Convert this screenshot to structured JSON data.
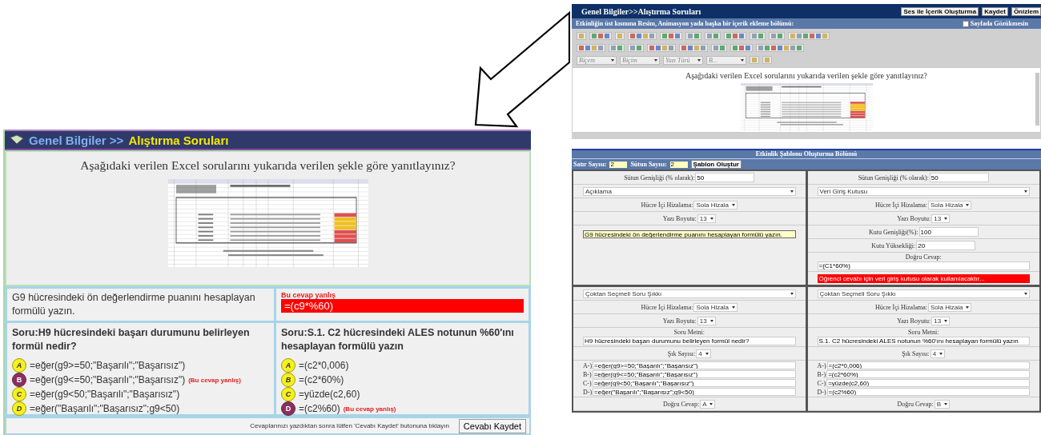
{
  "student_view": {
    "header": {
      "path": "Genel Bilgiler >>",
      "title": "Alıştırma Soruları"
    },
    "instruction": "Aşağıdaki verilen Excel sorularını yukarıda verilen şekle göre yanıtlayınız?",
    "open_question": {
      "text": "G9 hücresindeki ön değerlendirme puanını hesaplayan formülü yazın.",
      "error": "Bu cevap yanlış",
      "answer": "=(c9*%60)"
    },
    "choice_questions": [
      {
        "question": "Soru:H9 hücresindeki başarı durumunu belirleyen formül nedir?",
        "options": [
          {
            "letter": "A",
            "text": "=eğer(g9>=50;\"Başarılı\";\"Başarısız\")",
            "selected": false
          },
          {
            "letter": "B",
            "text": "=eğer(g9<=50;\"Başarılı\";\"Başarısız\")",
            "selected": true,
            "note": "(Bu cevap yanlış)"
          },
          {
            "letter": "C",
            "text": "=eğer(g9<50;\"Başarılı\";\"Başarısız\")",
            "selected": false
          },
          {
            "letter": "D",
            "text": "=eğer(\"Başarılı\";\"Başarısız\";g9<50)",
            "selected": false
          }
        ]
      },
      {
        "question": "Soru:S.1. C2 hücresindeki ALES notunun %60'ını hesaplayan formülü yazın",
        "options": [
          {
            "letter": "A",
            "text": "=(c2*0,006)",
            "selected": false
          },
          {
            "letter": "B",
            "text": "=(c2*60%)",
            "selected": false
          },
          {
            "letter": "C",
            "text": "=yüzde(c2,60)",
            "selected": false
          },
          {
            "letter": "D",
            "text": "=(c2%60)",
            "selected": true,
            "note": "(Bu cevap yanlış)"
          }
        ]
      }
    ],
    "footer": {
      "note": "Cevaplarınızı yazdıktan sonra lütfen 'Cevabı Kaydet' butonuna tıklayın",
      "button": "Cevabı Kaydet"
    }
  },
  "editor_view": {
    "title": "Genel Bilgiler>>Alıştırma Soruları",
    "buttons": [
      "Ses ile İçerik Oluşturma",
      "Kaydet",
      "Önizlem"
    ],
    "content_bar": {
      "label": "Etkinliğin üst kısmına Resim, Animasyon yada başka bir içerik ekleme bölümü:",
      "hide_label": "Sayfada Gözükmesin",
      "checked": false
    },
    "combos": [
      "Biçem",
      "Biçim",
      "Yazı Türü",
      "B..."
    ],
    "instruction": "Aşağıdaki verilen Excel sorularını yukarıda verilen şekle göre yanıtlayınız?",
    "template": {
      "title": "Etkinlik Şablonu Oluşturma Bölümü",
      "row_label": "Satır Sayısı:",
      "rows": "2",
      "col_label": "Sütun Sayısı:",
      "cols": "2",
      "button": "Şablon Oluştur",
      "cells": [
        {
          "fields": [
            {
              "kind": "input",
              "label": "Sütun Genişliği (% olarak):",
              "value": "50"
            },
            {
              "kind": "wide_select",
              "value": "Açıklama"
            },
            {
              "kind": "select",
              "label": "Hücre İçi Hizalama:",
              "value": "Sola Hizala"
            },
            {
              "kind": "select",
              "label": "Yazı Boyutu:",
              "value": "13"
            },
            {
              "kind": "text",
              "value": "G9 hücresindeki ön değerlendirme puanını hesaplayan formülü yazın."
            }
          ]
        },
        {
          "fields": [
            {
              "kind": "input",
              "label": "Sütun Genişliği (% olarak):",
              "value": "50"
            },
            {
              "kind": "wide_select",
              "value": "Veri Giriş Kutusu"
            },
            {
              "kind": "select",
              "label": "Hücre İçi Hizalama:",
              "value": "Sola Hizala"
            },
            {
              "kind": "select",
              "label": "Yazı Boyutu:",
              "value": "13"
            },
            {
              "kind": "input",
              "label": "Kutu Genişliği(%):",
              "value": "100"
            },
            {
              "kind": "input",
              "label": "Kutu Yüksekliği:",
              "value": "20"
            },
            {
              "kind": "stacked_input",
              "label": "Doğru Cevap:",
              "value": "=(C1*60%)"
            },
            {
              "kind": "warning",
              "value": "Öğrenci cevabı için veri giriş kutusu olarak kullanılacaktır..."
            }
          ]
        },
        {
          "fields": [
            {
              "kind": "wide_select",
              "value": "Çoktan Seçmeli Soru Şıkkı"
            },
            {
              "kind": "select",
              "label": "Hücre İçi Hizalama:",
              "value": "Sola Hizala"
            },
            {
              "kind": "select",
              "label": "Yazı Boyutu:",
              "value": "13"
            },
            {
              "kind": "stacked_input",
              "label": "Soru Metni:",
              "value": "H9 hücresindeki başarı durumunu belirleyen formül nedir?"
            },
            {
              "kind": "select",
              "label": "Şık Sayısı:",
              "value": "4"
            },
            {
              "kind": "options",
              "options": [
                {
                  "label": "A-)",
                  "value": "=eğer(g9>=50;\"Başarılı\";\"Başarısız\")"
                },
                {
                  "label": "B-)",
                  "value": "=eğer(g9<=50;\"Başarılı\";\"Başarısız\")"
                },
                {
                  "label": "C-)",
                  "value": "=eğer(g9<50;\"Başarılı\";\"Başarısız\")"
                },
                {
                  "label": "D-)",
                  "value": "=eğer(\"Başarılı\";\"Başarısız\";g9<50)"
                }
              ]
            },
            {
              "kind": "select",
              "label": "Doğru Cevap:",
              "value": "A"
            }
          ]
        },
        {
          "fields": [
            {
              "kind": "wide_select",
              "value": "Çoktan Seçmeli Soru Şıkkı"
            },
            {
              "kind": "select",
              "label": "Hücre İçi Hizalama:",
              "value": "Sola Hizala"
            },
            {
              "kind": "select",
              "label": "Yazı Boyutu:",
              "value": "13"
            },
            {
              "kind": "stacked_input",
              "label": "Soru Metni:",
              "value": "S.1. C2 hücresindeki ALES notunun %60'ını hesaplayan formülü yazın"
            },
            {
              "kind": "select",
              "label": "Şık Sayısı:",
              "value": "4"
            },
            {
              "kind": "options",
              "options": [
                {
                  "label": "A-)",
                  "value": "=(c2*0,006)"
                },
                {
                  "label": "B-)",
                  "value": "=(c2*60%)"
                },
                {
                  "label": "C-)",
                  "value": "=yüzde(c2,60)"
                },
                {
                  "label": "D-)",
                  "value": "=(c2%60)"
                }
              ]
            },
            {
              "kind": "select",
              "label": "Doğru Cevap:",
              "value": "B"
            }
          ]
        }
      ]
    }
  }
}
